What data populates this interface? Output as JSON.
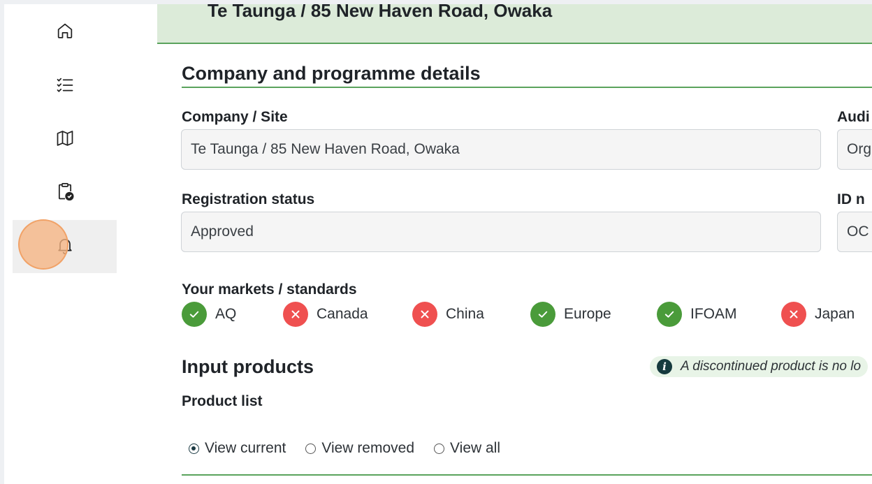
{
  "banner": {
    "text": "Te Taunga / 85 New Haven Road, Owaka"
  },
  "sidebar": {
    "items": [
      {
        "name": "home",
        "icon": "home-icon"
      },
      {
        "name": "checklist",
        "icon": "checklist-icon"
      },
      {
        "name": "map",
        "icon": "map-icon"
      },
      {
        "name": "clipboard",
        "icon": "clipboard-check-icon"
      },
      {
        "name": "notifications",
        "icon": "bell-icon",
        "active": true
      }
    ]
  },
  "section": {
    "title": "Company and programme details"
  },
  "fields": {
    "company_site": {
      "label": "Company / Site",
      "value": "Te Taunga / 85 New Haven Road, Owaka"
    },
    "audit": {
      "label": "Audi",
      "value": "Org"
    },
    "registration_status": {
      "label": "Registration status",
      "value": "Approved"
    },
    "id_number": {
      "label": "ID n",
      "value": "OC"
    }
  },
  "markets": {
    "label": "Your markets / standards",
    "items": [
      {
        "name": "AQ",
        "status": "ok"
      },
      {
        "name": "Canada",
        "status": "no"
      },
      {
        "name": "China",
        "status": "no"
      },
      {
        "name": "Europe",
        "status": "ok"
      },
      {
        "name": "IFOAM",
        "status": "ok"
      },
      {
        "name": "Japan",
        "status": "no"
      }
    ]
  },
  "input_products": {
    "title": "Input products",
    "info": "A discontinued product is no lo",
    "product_list_label": "Product list",
    "radios": [
      {
        "label": "View current",
        "checked": true
      },
      {
        "label": "View removed",
        "checked": false
      },
      {
        "label": "View all",
        "checked": false
      }
    ]
  },
  "colors": {
    "accent_green": "#5aa35c",
    "ok_badge": "#4a9b3a",
    "no_badge": "#ef5050",
    "banner_bg": "#dcebd9"
  }
}
